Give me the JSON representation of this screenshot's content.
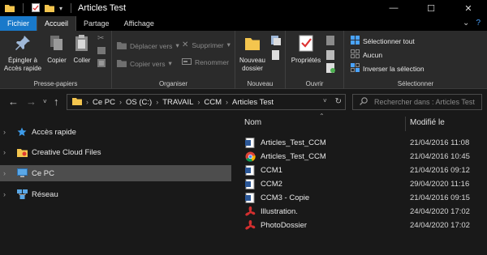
{
  "window": {
    "title": "Articles Test",
    "controls": {
      "minimize": "—",
      "maximize": "☐",
      "close": "✕"
    }
  },
  "ribbon_tabs": [
    {
      "label": "Fichier"
    },
    {
      "label": "Accueil"
    },
    {
      "label": "Partage"
    },
    {
      "label": "Affichage"
    }
  ],
  "ribbon_tab_right": {
    "expand": "⌄",
    "help": "?"
  },
  "ribbon": {
    "presse_papiers": {
      "label": "Presse-papiers",
      "pin": "Épingler à\nAccès rapide",
      "copy": "Copier",
      "paste": "Coller"
    },
    "organiser": {
      "label": "Organiser",
      "move": "Déplacer vers",
      "copy_to": "Copier vers",
      "delete": "Supprimer",
      "rename": "Renommer"
    },
    "nouveau": {
      "label": "Nouveau",
      "new_folder": "Nouveau\ndossier"
    },
    "ouvrir": {
      "label": "Ouvrir",
      "properties": "Propriétés"
    },
    "selectionner": {
      "label": "Sélectionner",
      "select_all": "Sélectionner tout",
      "none": "Aucun",
      "invert": "Inverser la sélection"
    }
  },
  "address": {
    "crumbs": [
      "Ce PC",
      "OS (C:)",
      "TRAVAIL",
      "CCM",
      "Articles Test"
    ],
    "search_placeholder": "Rechercher dans : Articles Test"
  },
  "nav": {
    "items": [
      {
        "label": "Accès rapide",
        "icon": "star-icon"
      },
      {
        "label": "Creative Cloud Files",
        "icon": "cloud-folder-icon"
      },
      {
        "label": "Ce PC",
        "icon": "computer-icon"
      },
      {
        "label": "Réseau",
        "icon": "network-icon"
      }
    ]
  },
  "columns": {
    "name": "Nom",
    "modified": "Modifié le"
  },
  "files": [
    {
      "name": "Articles_Test_CCM",
      "date": "21/04/2016 11:08",
      "icon": "word-doc-icon"
    },
    {
      "name": "Articles_Test_CCM",
      "date": "21/04/2016 10:45",
      "icon": "chrome-html-icon"
    },
    {
      "name": "CCM1",
      "date": "21/04/2016 09:12",
      "icon": "word-doc-icon"
    },
    {
      "name": "CCM2",
      "date": "29/04/2020 11:16",
      "icon": "word-doc-icon"
    },
    {
      "name": "CCM3 - Copie",
      "date": "21/04/2016 09:15",
      "icon": "word-doc-icon"
    },
    {
      "name": "Illustration.",
      "date": "24/04/2020 17:02",
      "icon": "acrobat-pdf-icon"
    },
    {
      "name": "PhotoDossier",
      "date": "24/04/2020 17:02",
      "icon": "acrobat-pdf-icon"
    }
  ],
  "colors": {
    "accent": "#1979ca",
    "background": "#191919",
    "ribbon": "#2b2b2b",
    "selected": "#4d4d4d",
    "folder": "#f4c54e"
  }
}
